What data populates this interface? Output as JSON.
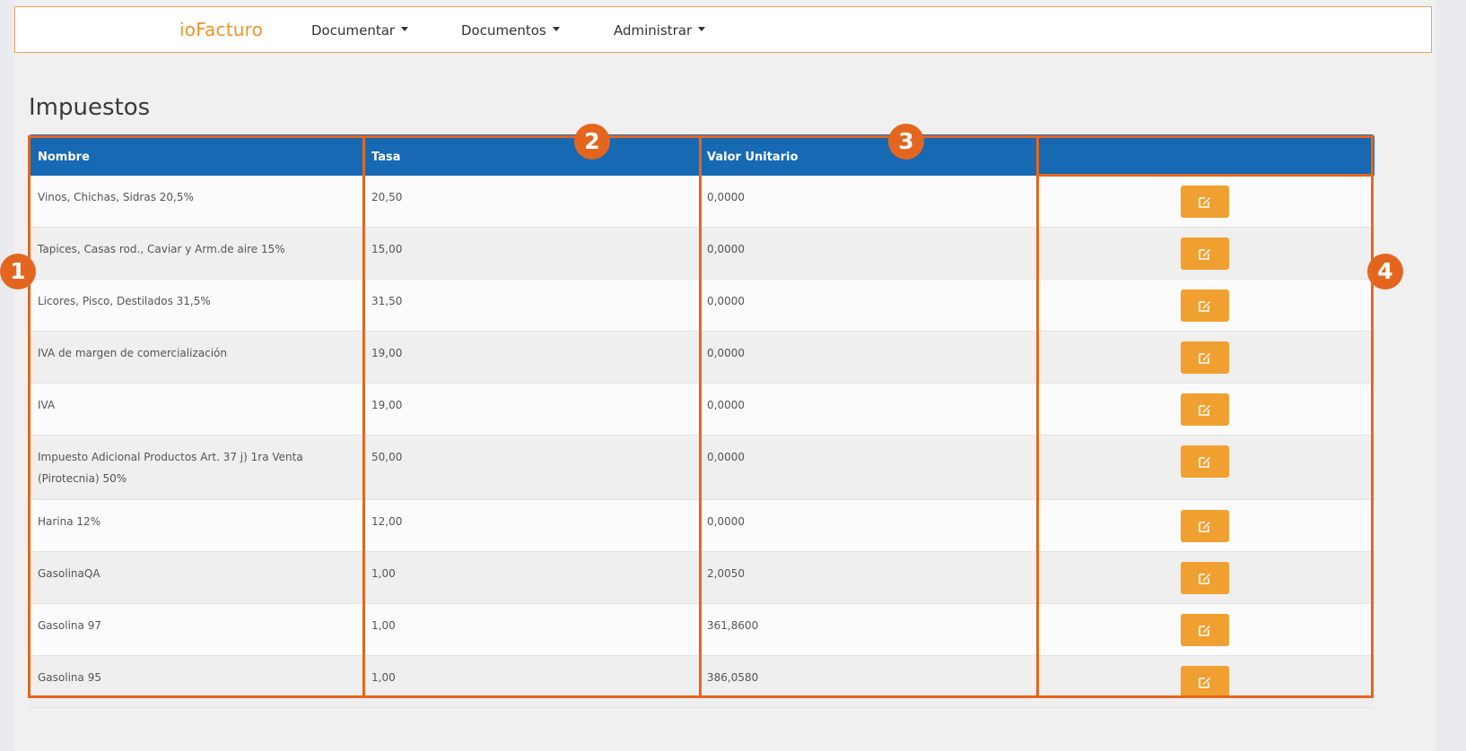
{
  "app": {
    "brand": "ioFacturo"
  },
  "nav": [
    {
      "label": "Documentar"
    },
    {
      "label": "Documentos"
    },
    {
      "label": "Administrar"
    }
  ],
  "page": {
    "title": "Impuestos"
  },
  "table": {
    "headers": {
      "nombre": "Nombre",
      "tasa": "Tasa",
      "valor": "Valor Unitario",
      "actions": ""
    },
    "rows": [
      {
        "nombre": "Vinos, Chichas, Sidras 20,5%",
        "tasa": "20,50",
        "valor": "0,0000"
      },
      {
        "nombre": "Tapices, Casas rod., Caviar y Arm.de aire 15%",
        "tasa": "15,00",
        "valor": "0,0000"
      },
      {
        "nombre": "Licores, Pisco, Destilados 31,5%",
        "tasa": "31,50",
        "valor": "0,0000"
      },
      {
        "nombre": "IVA de margen de comercialización",
        "tasa": "19,00",
        "valor": "0,0000"
      },
      {
        "nombre": "IVA",
        "tasa": "19,00",
        "valor": "0,0000"
      },
      {
        "nombre": "Impuesto Adicional Productos Art. 37 j) 1ra Venta (Pirotecnia) 50%",
        "tasa": "50,00",
        "valor": "0,0000"
      },
      {
        "nombre": "Harina 12%",
        "tasa": "12,00",
        "valor": "0,0000"
      },
      {
        "nombre": "GasolinaQA",
        "tasa": "1,00",
        "valor": "2,0050"
      },
      {
        "nombre": "Gasolina 97",
        "tasa": "1,00",
        "valor": "361,8600"
      },
      {
        "nombre": "Gasolina 95",
        "tasa": "1,00",
        "valor": "386,0580"
      }
    ],
    "row_action_icon": "edit-icon"
  },
  "annotations": [
    "1",
    "2",
    "3",
    "4"
  ],
  "colors": {
    "brand": "#f0932b",
    "header": "#1769b3",
    "button": "#f0a030",
    "annotation": "#e4661e"
  }
}
